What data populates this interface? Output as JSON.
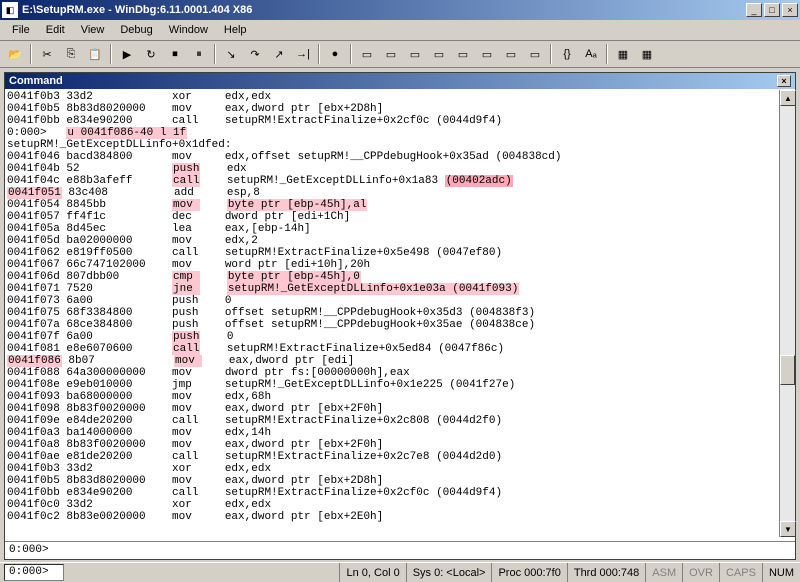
{
  "window": {
    "title": "E:\\SetupRM.exe - WinDbg:6.11.0001.404 X86",
    "minimize": "_",
    "maximize": "□",
    "close": "×"
  },
  "menu": {
    "file": "File",
    "edit": "Edit",
    "view": "View",
    "debug": "Debug",
    "window": "Window",
    "help": "Help"
  },
  "command": {
    "title": "Command",
    "close": "×",
    "prompt": "0:000>"
  },
  "disasm": {
    "lines": [
      {
        "addr": "0041f0b3",
        "bytes": "33d2",
        "op": "xor",
        "args": "edx,edx"
      },
      {
        "addr": "0041f0b5",
        "bytes": "8b83d8020000",
        "op": "mov",
        "args": "eax,dword ptr [ebx+2D8h]"
      },
      {
        "addr": "0041f0bb",
        "bytes": "e834e90200",
        "op": "call",
        "args": "setupRM!ExtractFinalize+0x2cf0c (0044d9f4)"
      },
      {
        "addr": "0:000>",
        "bytes": "u 0041f086-40 l 1f",
        "hl": "cmd"
      },
      {
        "addr": "setupRM!_GetExceptDLLinfo+0x1dfed:"
      },
      {
        "addr": "0041f046",
        "bytes": "bacd384800",
        "op": "mov",
        "args": "edx,offset setupRM!__CPPdebugHook+0x35ad (004838cd)"
      },
      {
        "addr": "0041f04b",
        "bytes": "52",
        "op": "push",
        "args": "edx",
        "hl_op": true
      },
      {
        "addr": "0041f04c",
        "bytes": "e88b3afeff",
        "op": "call",
        "args": "setupRM!_GetExceptDLLinfo+0x1a83 ",
        "hl_op": true,
        "hl_tail": "(00402adc)"
      },
      {
        "addr": "0041f051",
        "bytes": "83c408",
        "op": "add",
        "args": "esp,8",
        "hl_addr": true
      },
      {
        "addr": "0041f054",
        "bytes": "8845bb",
        "op": "mov",
        "args": "byte ptr [ebp-45h],al",
        "hl_op": true,
        "hl_args": true
      },
      {
        "addr": "0041f057",
        "bytes": "ff4f1c",
        "op": "dec",
        "args": "dword ptr [edi+1Ch]"
      },
      {
        "addr": "0041f05a",
        "bytes": "8d45ec",
        "op": "lea",
        "args": "eax,[ebp-14h]"
      },
      {
        "addr": "0041f05d",
        "bytes": "ba02000000",
        "op": "mov",
        "args": "edx,2"
      },
      {
        "addr": "0041f062",
        "bytes": "e819ff0500",
        "op": "call",
        "args": "setupRM!ExtractFinalize+0x5e498 (0047ef80)"
      },
      {
        "addr": "0041f067",
        "bytes": "66c747102000",
        "op": "mov",
        "args": "word ptr [edi+10h],20h"
      },
      {
        "addr": "0041f06d",
        "bytes": "807dbb00",
        "op": "cmp",
        "args": "byte ptr [ebp-45h],0",
        "hl_op": true,
        "hl_args": true
      },
      {
        "addr": "0041f071",
        "bytes": "7520",
        "op": "jne",
        "args": "setupRM!_GetExceptDLLinfo+0x1e03a (0041f093)",
        "hl_op": true,
        "hl_args": true
      },
      {
        "addr": "0041f073",
        "bytes": "6a00",
        "op": "push",
        "args": "0"
      },
      {
        "addr": "0041f075",
        "bytes": "68f3384800",
        "op": "push",
        "args": "offset setupRM!__CPPdebugHook+0x35d3 (004838f3)"
      },
      {
        "addr": "0041f07a",
        "bytes": "68ce384800",
        "op": "push",
        "args": "offset setupRM!__CPPdebugHook+0x35ae (004838ce)"
      },
      {
        "addr": "0041f07f",
        "bytes": "6a00",
        "op": "push",
        "args": "0",
        "hl_op": true
      },
      {
        "addr": "0041f081",
        "bytes": "e8e6070600",
        "op": "call",
        "args": "setupRM!ExtractFinalize+0x5ed84 (0047f86c)",
        "hl_op": true
      },
      {
        "addr": "0041f086",
        "bytes": "8b07",
        "op": "mov",
        "args": "eax,dword ptr [edi]",
        "hl_addr": true,
        "hl_op": true
      },
      {
        "addr": "0041f088",
        "bytes": "64a300000000",
        "op": "mov",
        "args": "dword ptr fs:[00000000h],eax"
      },
      {
        "addr": "0041f08e",
        "bytes": "e9eb010000",
        "op": "jmp",
        "args": "setupRM!_GetExceptDLLinfo+0x1e225 (0041f27e)"
      },
      {
        "addr": "0041f093",
        "bytes": "ba68000000",
        "op": "mov",
        "args": "edx,68h"
      },
      {
        "addr": "0041f098",
        "bytes": "8b83f0020000",
        "op": "mov",
        "args": "eax,dword ptr [ebx+2F0h]"
      },
      {
        "addr": "0041f09e",
        "bytes": "e84de20200",
        "op": "call",
        "args": "setupRM!ExtractFinalize+0x2c808 (0044d2f0)"
      },
      {
        "addr": "0041f0a3",
        "bytes": "ba14000000",
        "op": "mov",
        "args": "edx,14h"
      },
      {
        "addr": "0041f0a8",
        "bytes": "8b83f0020000",
        "op": "mov",
        "args": "eax,dword ptr [ebx+2F0h]"
      },
      {
        "addr": "0041f0ae",
        "bytes": "e81de20200",
        "op": "call",
        "args": "setupRM!ExtractFinalize+0x2c7e8 (0044d2d0)"
      },
      {
        "addr": "0041f0b3",
        "bytes": "33d2",
        "op": "xor",
        "args": "edx,edx"
      },
      {
        "addr": "0041f0b5",
        "bytes": "8b83d8020000",
        "op": "mov",
        "args": "eax,dword ptr [ebx+2D8h]"
      },
      {
        "addr": "0041f0bb",
        "bytes": "e834e90200",
        "op": "call",
        "args": "setupRM!ExtractFinalize+0x2cf0c (0044d9f4)"
      },
      {
        "addr": "0041f0c0",
        "bytes": "33d2",
        "op": "xor",
        "args": "edx,edx"
      },
      {
        "addr": "0041f0c2",
        "bytes": "8b83e0020000",
        "op": "mov",
        "args": "eax,dword ptr [ebx+2E0h]"
      }
    ]
  },
  "status": {
    "prompt": "0:000>",
    "lncol": "Ln 0, Col 0",
    "sys": "Sys 0: <Local>",
    "proc": "Proc 000:7f0",
    "thrd": "Thrd 000:748",
    "asm": "ASM",
    "ovr": "OVR",
    "caps": "CAPS",
    "num": "NUM"
  }
}
